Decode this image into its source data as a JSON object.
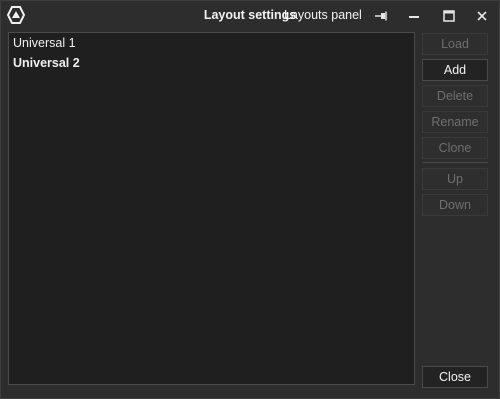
{
  "window": {
    "title": "Layout settings",
    "panel_label": "Layouts panel"
  },
  "icons": {
    "logo": "app-logo-icon",
    "pin": "pin-icon",
    "minimize": "minimize-icon",
    "maximize": "maximize-icon",
    "close": "close-icon"
  },
  "layouts": {
    "items": [
      {
        "label": "Universal 1",
        "bold": false
      },
      {
        "label": "Universal 2",
        "bold": true
      }
    ]
  },
  "buttons": {
    "load": "Load",
    "add": "Add",
    "delete": "Delete",
    "rename": "Rename",
    "clone": "Clone",
    "up": "Up",
    "down": "Down",
    "close": "Close"
  },
  "colors": {
    "window_bg": "#2d2d2d",
    "list_bg": "#1f1f1f",
    "text": "#f2f2f2",
    "disabled_text": "#6f6f6f"
  }
}
